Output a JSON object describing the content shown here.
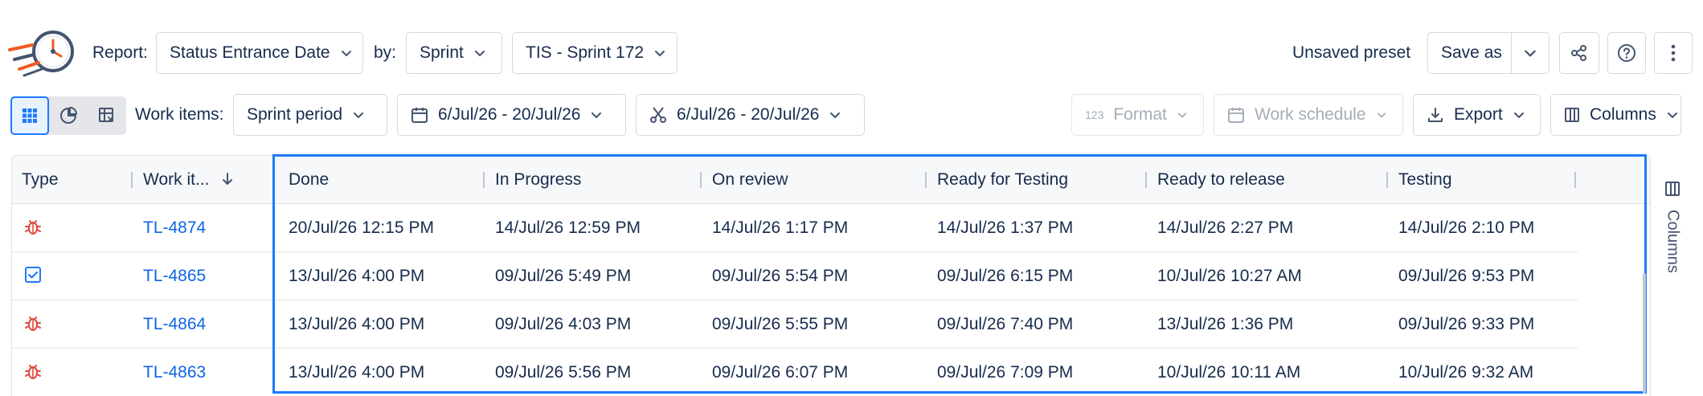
{
  "toolbar": {
    "report_label": "Report:",
    "report_value": "Status Entrance Date",
    "by_label": "by:",
    "by_value": "Sprint",
    "sprint_value": "TIS - Sprint 172",
    "preset_status": "Unsaved preset",
    "save_as_label": "Save as"
  },
  "filters": {
    "work_items_label": "Work items:",
    "period_value": "Sprint period",
    "date_range_1": "6/Jul/26 - 20/Jul/26",
    "date_range_2": "6/Jul/26 - 20/Jul/26",
    "format_label": "Format",
    "work_schedule_label": "Work schedule",
    "export_label": "Export",
    "columns_label": "Columns"
  },
  "table": {
    "headers": [
      "Type",
      "Work it...",
      "Done",
      "In Progress",
      "On review",
      "Ready for Testing",
      "Ready to release",
      "Testing"
    ],
    "rows": [
      {
        "type_icon": "bug-icon",
        "key": "TL-4874",
        "cells": [
          "20/Jul/26 12:15 PM",
          "14/Jul/26 12:59 PM",
          "14/Jul/26 1:17 PM",
          "14/Jul/26 1:37 PM",
          "14/Jul/26 2:27 PM",
          "14/Jul/26 2:10 PM"
        ]
      },
      {
        "type_icon": "task-icon",
        "key": "TL-4865",
        "cells": [
          "13/Jul/26 4:00 PM",
          "09/Jul/26 5:49 PM",
          "09/Jul/26 5:54 PM",
          "09/Jul/26 6:15 PM",
          "10/Jul/26 10:27 AM",
          "09/Jul/26 9:53 PM"
        ]
      },
      {
        "type_icon": "bug-icon",
        "key": "TL-4864",
        "cells": [
          "13/Jul/26 4:00 PM",
          "09/Jul/26 4:03 PM",
          "09/Jul/26 5:55 PM",
          "09/Jul/26 7:40 PM",
          "13/Jul/26 1:36 PM",
          "09/Jul/26 9:33 PM"
        ]
      },
      {
        "type_icon": "bug-icon",
        "key": "TL-4863",
        "cells": [
          "13/Jul/26 4:00 PM",
          "09/Jul/26 5:56 PM",
          "09/Jul/26 6:07 PM",
          "09/Jul/26 7:09 PM",
          "10/Jul/26 10:11 AM",
          "10/Jul/26 9:32 AM"
        ]
      }
    ]
  },
  "side_panel": {
    "label": "Columns"
  },
  "colors": {
    "accent": "#1d7afc",
    "link": "#0c66e4",
    "bug": "#e2483d",
    "logo_orange": "#f15a24",
    "logo_dark": "#2c3e50"
  }
}
